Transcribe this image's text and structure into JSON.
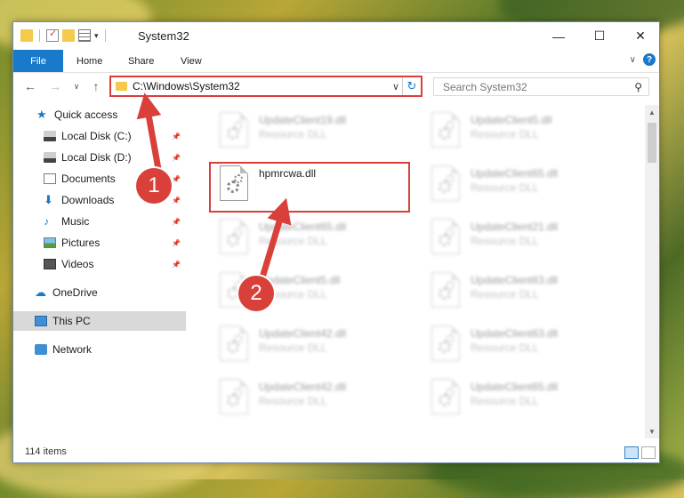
{
  "window": {
    "title": "System32",
    "minimize": "—",
    "maximize": "☐",
    "close": "✕"
  },
  "ribbon": {
    "tabs": [
      "File",
      "Home",
      "Share",
      "View"
    ],
    "help": "?"
  },
  "navigation": {
    "back": "←",
    "forward": "→",
    "recent": "∨",
    "up": "↑",
    "address": "C:\\Windows\\System32",
    "search_placeholder": "Search System32"
  },
  "sidebar": {
    "items": [
      {
        "label": "Quick access",
        "icon": "star-icon"
      },
      {
        "label": "Local Disk (C:)",
        "icon": "drive-icon",
        "pinned": true
      },
      {
        "label": "Local Disk (D:)",
        "icon": "drive-icon",
        "pinned": true
      },
      {
        "label": "Documents",
        "icon": "documents-icon",
        "pinned": true
      },
      {
        "label": "Downloads",
        "icon": "download-icon",
        "pinned": true
      },
      {
        "label": "Music",
        "icon": "music-icon",
        "pinned": true
      },
      {
        "label": "Pictures",
        "icon": "pictures-icon",
        "pinned": true
      },
      {
        "label": "Videos",
        "icon": "videos-icon",
        "pinned": true
      },
      {
        "label": "OneDrive",
        "icon": "cloud-icon"
      },
      {
        "label": "This PC",
        "icon": "computer-icon",
        "selected": true
      },
      {
        "label": "Network",
        "icon": "network-icon"
      }
    ]
  },
  "files": [
    {
      "name": "UpdateClient19.dll",
      "type": "Resource DLL"
    },
    {
      "name": "UpdateClient5.dll",
      "type": "Resource DLL"
    },
    {
      "name": "hpmrcwa.dll",
      "type": ""
    },
    {
      "name": "UpdateClient65.dll",
      "type": "Resource DLL"
    },
    {
      "name": "UpdateClient65.dll",
      "type": "Resource DLL"
    },
    {
      "name": "UpdateClient21.dll",
      "type": "Resource DLL"
    },
    {
      "name": "UpdateClient5.dll",
      "type": "Resource DLL"
    },
    {
      "name": "UpdateClient63.dll",
      "type": "Resource DLL"
    },
    {
      "name": "UpdateClient42.dll",
      "type": "Resource DLL"
    },
    {
      "name": "UpdateClient63.dll",
      "type": "Resource DLL"
    },
    {
      "name": "UpdateClient42.dll",
      "type": "Resource DLL"
    },
    {
      "name": "UpdateClient65.dll",
      "type": "Resource DLL"
    }
  ],
  "annotations": {
    "step1": "1",
    "step2": "2",
    "color": "#d9403a"
  },
  "status": {
    "item_count": "114 items"
  }
}
